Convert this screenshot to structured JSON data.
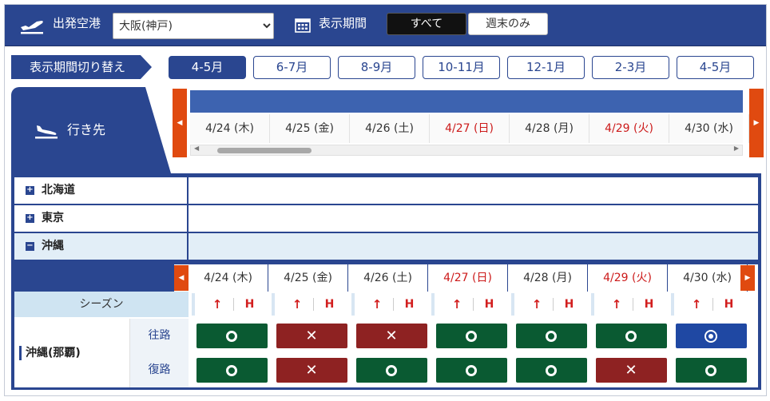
{
  "topbar": {
    "airport_label": "出発空港",
    "airport_value": "大阪(神戸)",
    "period_label": "表示期間",
    "filter_all": "すべて",
    "filter_weekend": "週末のみ"
  },
  "period_switch": {
    "label": "表示期間切り替え",
    "buttons": [
      "4-5月",
      "6-7月",
      "8-9月",
      "10-11月",
      "12-1月",
      "2-3月",
      "4-5月"
    ],
    "active_index": 0
  },
  "destination_header": "行き先",
  "dates": [
    {
      "label": "4/24 (木)",
      "holiday": false
    },
    {
      "label": "4/25 (金)",
      "holiday": false
    },
    {
      "label": "4/26 (土)",
      "holiday": false
    },
    {
      "label": "4/27 (日)",
      "holiday": true
    },
    {
      "label": "4/28 (月)",
      "holiday": false
    },
    {
      "label": "4/29 (火)",
      "holiday": true
    },
    {
      "label": "4/30 (水)",
      "holiday": false
    }
  ],
  "regions": [
    {
      "name": "北海道",
      "expanded": false
    },
    {
      "name": "東京",
      "expanded": false
    },
    {
      "name": "沖縄",
      "expanded": true
    }
  ],
  "season": {
    "label": "シーズン",
    "up_icon": "↑",
    "h_label": "H"
  },
  "destination": {
    "name": "沖縄(那覇)",
    "outbound_label": "往路",
    "return_label": "復路",
    "outbound": [
      "ok",
      "ng",
      "ng",
      "ok",
      "ok",
      "ok",
      "best"
    ],
    "return": [
      "ok",
      "ng",
      "ok",
      "ok",
      "ok",
      "ng",
      "ok"
    ]
  },
  "colors": {
    "primary": "#2a4690",
    "accent": "#e04a10",
    "available": "#0a5a32",
    "unavailable": "#8e2222",
    "recommended": "#1f48a3",
    "holiday_text": "#cc1a1a"
  }
}
